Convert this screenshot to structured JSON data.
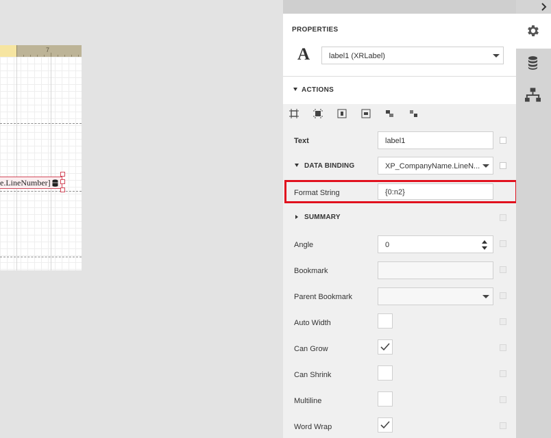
{
  "ruler": {
    "mark": "7"
  },
  "surface": {
    "label_text": "e.LineNumber]"
  },
  "panel": {
    "title": "PROPERTIES",
    "control_icon": "A",
    "selected_control": "label1 (XRLabel)",
    "actions_header": "ACTIONS",
    "action_icons": [
      "align-to-grid-icon",
      "size-to-grid-icon",
      "center-horizontally-icon",
      "center-vertically-icon",
      "bring-to-front-icon",
      "send-to-back-icon"
    ],
    "properties": {
      "text": {
        "label": "Text",
        "value": "label1"
      },
      "data_binding": {
        "header": "DATA BINDING",
        "value": "XP_CompanyName.LineN..."
      },
      "format_string": {
        "label": "Format String",
        "value": "{0:n2}"
      },
      "summary": {
        "header": "SUMMARY"
      },
      "angle": {
        "label": "Angle",
        "value": "0"
      },
      "bookmark": {
        "label": "Bookmark",
        "value": ""
      },
      "parent_bookmark": {
        "label": "Parent Bookmark",
        "value": ""
      },
      "auto_width": {
        "label": "Auto Width",
        "checked": false
      },
      "can_grow": {
        "label": "Can Grow",
        "checked": true
      },
      "can_shrink": {
        "label": "Can Shrink",
        "checked": false
      },
      "multiline": {
        "label": "Multiline",
        "checked": false
      },
      "word_wrap": {
        "label": "Word Wrap",
        "checked": true
      }
    }
  },
  "tabs": [
    "gear-icon",
    "database-icon",
    "hierarchy-icon"
  ],
  "colors": {
    "highlight": "#e1111e",
    "selection": "#d3485a",
    "ruler": "#bdb497",
    "ruler_highlight": "#f6e5a1"
  }
}
